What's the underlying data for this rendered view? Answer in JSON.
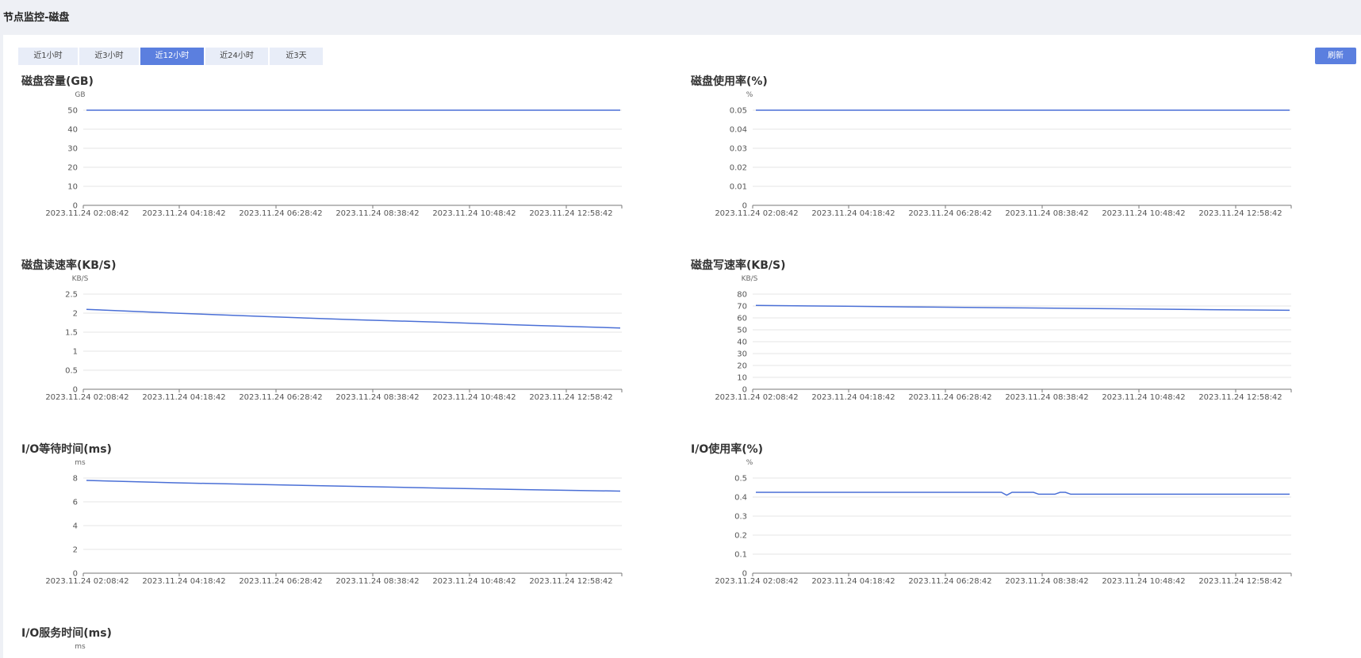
{
  "page": {
    "title": "节点监控-磁盘"
  },
  "tabs": [
    {
      "label": "近1小时",
      "active": false
    },
    {
      "label": "近3小时",
      "active": false
    },
    {
      "label": "近12小时",
      "active": true
    },
    {
      "label": "近24小时",
      "active": false
    },
    {
      "label": "近3天",
      "active": false
    }
  ],
  "toolbar": {
    "refresh_label": "刷新"
  },
  "colors": {
    "accent": "#5b7fdf",
    "series": "#4a6fd6"
  },
  "chart_data": [
    {
      "id": "disk-capacity",
      "type": "line",
      "title": "磁盘容量(GB)",
      "unit": "GB",
      "ylim": [
        0,
        50
      ],
      "yticks": [
        "0",
        "10",
        "20",
        "30",
        "40",
        "50"
      ],
      "x_labels": [
        "2023.11.24 02:08:42",
        "2023.11.24 04:18:42",
        "2023.11.24 06:28:42",
        "2023.11.24 08:38:42",
        "2023.11.24 10:48:42",
        "2023.11.24 12:58:42"
      ],
      "series": [
        {
          "values": [
            50,
            50,
            50,
            50,
            50,
            50,
            50
          ]
        }
      ]
    },
    {
      "id": "disk-usage-rate",
      "type": "line",
      "title": "磁盘使用率(%)",
      "unit": "%",
      "ylim": [
        0,
        0.05
      ],
      "yticks": [
        "0",
        "0.01",
        "0.02",
        "0.03",
        "0.04",
        "0.05"
      ],
      "x_labels": [
        "2023.11.24 02:08:42",
        "2023.11.24 04:18:42",
        "2023.11.24 06:28:42",
        "2023.11.24 08:38:42",
        "2023.11.24 10:48:42",
        "2023.11.24 12:58:42"
      ],
      "series": [
        {
          "values": [
            0.05,
            0.05,
            0.05,
            0.05,
            0.05,
            0.05,
            0.05
          ]
        }
      ]
    },
    {
      "id": "disk-read-rate",
      "type": "line",
      "title": "磁盘读速率(KB/S)",
      "unit": "KB/S",
      "ylim": [
        0,
        2.5
      ],
      "yticks": [
        "0",
        "0.5",
        "1",
        "1.5",
        "2",
        "2.5"
      ],
      "x_labels": [
        "2023.11.24 02:08:42",
        "2023.11.24 04:18:42",
        "2023.11.24 06:28:42",
        "2023.11.24 08:38:42",
        "2023.11.24 10:48:42",
        "2023.11.24 12:58:42"
      ],
      "series": [
        {
          "values": [
            2.1,
            2.0,
            1.91,
            1.83,
            1.76,
            1.68,
            1.61
          ]
        }
      ]
    },
    {
      "id": "disk-write-rate",
      "type": "line",
      "title": "磁盘写速率(KB/S)",
      "unit": "KB/S",
      "ylim": [
        0,
        80
      ],
      "yticks": [
        "0",
        "10",
        "20",
        "30",
        "40",
        "50",
        "60",
        "70",
        "80"
      ],
      "x_labels": [
        "2023.11.24 02:08:42",
        "2023.11.24 04:18:42",
        "2023.11.24 06:28:42",
        "2023.11.24 08:38:42",
        "2023.11.24 10:48:42",
        "2023.11.24 12:58:42"
      ],
      "series": [
        {
          "values": [
            70.5,
            69.8,
            69.1,
            68.4,
            67.7,
            67.0,
            66.4
          ]
        }
      ]
    },
    {
      "id": "io-wait-time",
      "type": "line",
      "title": "I/O等待时间(ms)",
      "unit": "ms",
      "ylim": [
        0,
        8
      ],
      "yticks": [
        "0",
        "2",
        "4",
        "6",
        "8"
      ],
      "x_labels": [
        "2023.11.24 02:08:42",
        "2023.11.24 04:18:42",
        "2023.11.24 06:28:42",
        "2023.11.24 08:38:42",
        "2023.11.24 10:48:42",
        "2023.11.24 12:58:42"
      ],
      "series": [
        {
          "values": [
            7.8,
            7.6,
            7.45,
            7.3,
            7.15,
            7.02,
            6.9
          ]
        }
      ]
    },
    {
      "id": "io-usage-rate",
      "type": "line",
      "title": "I/O使用率(%)",
      "unit": "%",
      "ylim": [
        0,
        0.5
      ],
      "yticks": [
        "0",
        "0.1",
        "0.2",
        "0.3",
        "0.4",
        "0.5"
      ],
      "x_labels": [
        "2023.11.24 02:08:42",
        "2023.11.24 04:18:42",
        "2023.11.24 06:28:42",
        "2023.11.24 08:38:42",
        "2023.11.24 10:48:42",
        "2023.11.24 12:58:42"
      ],
      "series": [
        {
          "values": [
            0.425,
            0.425,
            0.425,
            0.425,
            0.425,
            0.425,
            0.425,
            0.425,
            0.425,
            0.425,
            0.425,
            0.425,
            0.425,
            0.425,
            0.425,
            0.425,
            0.425,
            0.425,
            0.425,
            0.425,
            0.425,
            0.425,
            0.425,
            0.425,
            0.425,
            0.425,
            0.425,
            0.425,
            0.425,
            0.425,
            0.425,
            0.425,
            0.425,
            0.425,
            0.425,
            0.425,
            0.425,
            0.425,
            0.425,
            0.425,
            0.425,
            0.425,
            0.425,
            0.425,
            0.425,
            0.425,
            0.425,
            0.41,
            0.425,
            0.425,
            0.425,
            0.425,
            0.425,
            0.415,
            0.415,
            0.415,
            0.415,
            0.425,
            0.425,
            0.415,
            0.415,
            0.415,
            0.415,
            0.415,
            0.415,
            0.415,
            0.415,
            0.415,
            0.415,
            0.415,
            0.415,
            0.415,
            0.415,
            0.415,
            0.415,
            0.415,
            0.415,
            0.415,
            0.415,
            0.415,
            0.415,
            0.415,
            0.415,
            0.415,
            0.415,
            0.415,
            0.415,
            0.415,
            0.415,
            0.415,
            0.415,
            0.415,
            0.415,
            0.415,
            0.415,
            0.415,
            0.415,
            0.415,
            0.415,
            0.415,
            0.415
          ]
        }
      ]
    },
    {
      "id": "io-service-time",
      "type": "line",
      "title": "I/O服务时间(ms)",
      "unit": "ms",
      "series": []
    }
  ]
}
